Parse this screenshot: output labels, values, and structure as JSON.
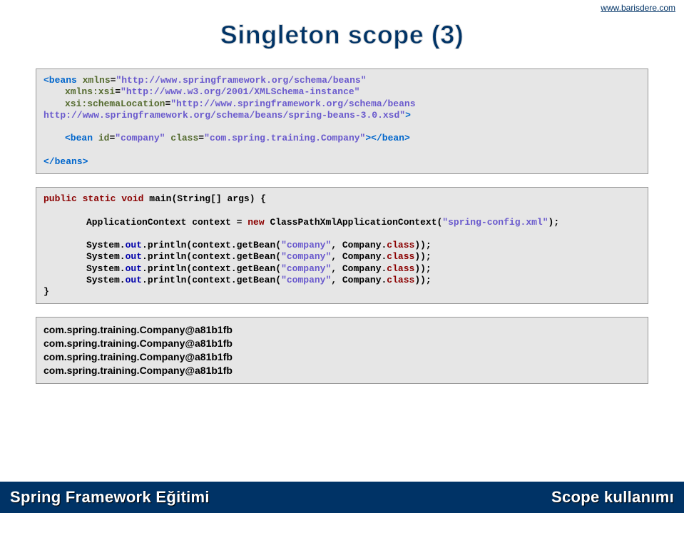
{
  "header": {
    "link": "www.barisdere.com"
  },
  "title": "Singleton scope (3)",
  "xml": {
    "beans_open": "<beans",
    "xmlns_attr": "xmlns",
    "xmlns_val": "\"http://www.springframework.org/schema/beans\"",
    "xmlnsxsi_attr": "xmlns:xsi",
    "xmlnsxsi_val": "\"http://www.w3.org/2001/XMLSchema-instance\"",
    "schemaloc_attr": "xsi:schemaLocation",
    "schemaloc_val": "\"http://www.springframework.org/schema/beans\nhttp://www.springframework.org/schema/beans/spring-beans-3.0.xsd\"",
    "close_open": ">",
    "bean_prefix": "<bean",
    "id_attr": "id",
    "id_val": "\"company\"",
    "class_attr": "class",
    "class_val": "\"com.spring.training.Company\"",
    "bean_close": "></bean>",
    "beans_close": "</beans>"
  },
  "java": {
    "public": "public",
    "static": "static",
    "void": "void",
    "main_sig": " main(String[] args) {",
    "ctx_decl": "ApplicationContext context = ",
    "new": "new",
    "ctx_ctor": " ClassPathXmlApplicationContext(",
    "cfg": "\"spring-config.xml\"",
    "ctx_end": ");",
    "sys": "System.",
    "out": "out",
    "print": ".println(context.getBean(",
    "company": "\"company\"",
    "comma": ", Company.",
    "class": "class",
    "end": "));",
    "brace": "}"
  },
  "output": {
    "l1": "com.spring.training.Company@a81b1fb",
    "l2": "com.spring.training.Company@a81b1fb",
    "l3": "com.spring.training.Company@a81b1fb",
    "l4": "com.spring.training.Company@a81b1fb"
  },
  "footer": {
    "left": "Spring Framework Eğitimi",
    "right": "Scope kullanımı"
  }
}
